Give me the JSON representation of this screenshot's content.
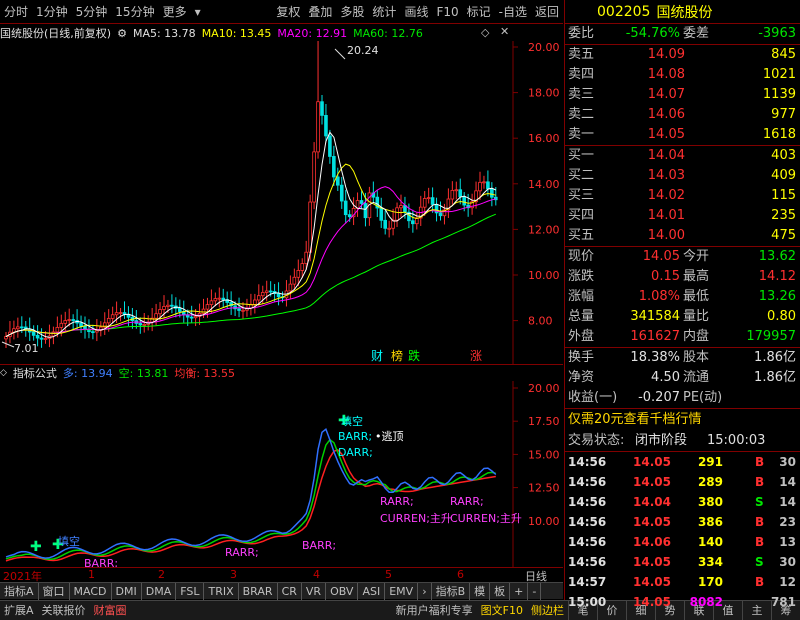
{
  "toolbar": {
    "left": [
      "分时",
      "1分钟",
      "5分钟",
      "15分钟",
      "更多"
    ],
    "right": [
      "复权",
      "叠加",
      "多股",
      "统计",
      "画线",
      "F10",
      "标记",
      "-自选",
      "返回"
    ]
  },
  "main_info": {
    "title": "国统股份(日线,前复权)",
    "ma5": "MA5: 13.78",
    "ma10": "MA10: 13.45",
    "ma20": "MA20: 12.91",
    "ma60": "MA60: 12.76"
  },
  "main_axis": [
    "20.00",
    "18.00",
    "16.00",
    "14.00",
    "12.00",
    "10.00",
    "8.00"
  ],
  "main_labels": {
    "high": "20.24",
    "low": "7.01",
    "tag1": "财",
    "tag2": "榜",
    "tag3": "跌",
    "tag4": "涨"
  },
  "sub_info": {
    "name": "指标公式",
    "duo": "多: 13.94",
    "kong": "空: 13.81",
    "junheng": "均衡: 13.55"
  },
  "sub_axis": [
    "20.00",
    "17.50",
    "15.00",
    "12.50",
    "10.00"
  ],
  "sub_labels": {
    "tiankong": "填空",
    "barr": "BARR;",
    "taoding": "•逃顶",
    "darr": "DARR;",
    "rarr": "RARR;",
    "curren": "CURREN;主升",
    "curren2": "CURREN;主升",
    "tiankong2": "填空",
    "barr2": "BARR;",
    "rarr_small": "RARR;"
  },
  "dates": {
    "year": "2021年",
    "m1": "1",
    "m2": "2",
    "m3": "3",
    "m4": "4",
    "m5": "5",
    "m6": "6",
    "period": "日线"
  },
  "tabs": [
    "指标A",
    "窗口",
    "MACD",
    "DMI",
    "DMA",
    "FSL",
    "TRIX",
    "BRAR",
    "CR",
    "VR",
    "OBV",
    "ASI",
    "EMV",
    "指标B",
    "模",
    "板",
    "+",
    "-"
  ],
  "bottom": {
    "items": [
      "扩展A",
      "关联报价",
      "财富圈"
    ],
    "promo": "新用户福利专享",
    "f10": "图文F10",
    "side": "侧边栏",
    "small": [
      "笔",
      "价",
      "细",
      "势",
      "联",
      "值",
      "主",
      "筹"
    ]
  },
  "quote": {
    "code": "002205",
    "name": "国统股份",
    "weibi_label": "委比",
    "weibi": "-54.76%",
    "weicha_label": "委差",
    "weicha": "-3963",
    "asks": [
      {
        "label": "卖五",
        "price": "14.09",
        "vol": "845"
      },
      {
        "label": "卖四",
        "price": "14.08",
        "vol": "1021"
      },
      {
        "label": "卖三",
        "price": "14.07",
        "vol": "1139"
      },
      {
        "label": "卖二",
        "price": "14.06",
        "vol": "977"
      },
      {
        "label": "卖一",
        "price": "14.05",
        "vol": "1618"
      }
    ],
    "bids": [
      {
        "label": "买一",
        "price": "14.04",
        "vol": "403"
      },
      {
        "label": "买二",
        "price": "14.03",
        "vol": "409"
      },
      {
        "label": "买三",
        "price": "14.02",
        "vol": "115"
      },
      {
        "label": "买四",
        "price": "14.01",
        "vol": "235"
      },
      {
        "label": "买五",
        "price": "14.00",
        "vol": "475"
      }
    ],
    "stats": [
      {
        "l1": "现价",
        "v1": "14.05",
        "c1": "red",
        "l2": "今开",
        "v2": "13.62",
        "c2": "green"
      },
      {
        "l1": "涨跌",
        "v1": "0.15",
        "c1": "red",
        "l2": "最高",
        "v2": "14.12",
        "c2": "red"
      },
      {
        "l1": "涨幅",
        "v1": "1.08%",
        "c1": "red",
        "l2": "最低",
        "v2": "13.26",
        "c2": "green"
      },
      {
        "l1": "总量",
        "v1": "341584",
        "c1": "yellow",
        "l2": "量比",
        "v2": "0.80",
        "c2": "yellow"
      },
      {
        "l1": "外盘",
        "v1": "161627",
        "c1": "red",
        "l2": "内盘",
        "v2": "179957",
        "c2": "green"
      }
    ],
    "stats2": [
      {
        "l1": "换手",
        "v1": "18.38%",
        "l2": "股本",
        "v2": "1.86亿"
      },
      {
        "l1": "净资",
        "v1": "4.50",
        "l2": "流通",
        "v2": "1.86亿"
      },
      {
        "l1": "收益(一)",
        "v1": "-0.207",
        "l2": "PE(动)",
        "v2": ""
      }
    ],
    "promo": "仅需20元查看千档行情",
    "status_label": "交易状态:",
    "status_value": "闭市阶段",
    "status_time": "15:00:03",
    "trades": [
      {
        "t": "14:56",
        "p": "14.05",
        "q": "291",
        "bs": "B",
        "n": "30"
      },
      {
        "t": "14:56",
        "p": "14.05",
        "q": "289",
        "bs": "B",
        "n": "14"
      },
      {
        "t": "14:56",
        "p": "14.04",
        "q": "380",
        "bs": "S",
        "n": "14"
      },
      {
        "t": "14:56",
        "p": "14.05",
        "q": "386",
        "bs": "B",
        "n": "23"
      },
      {
        "t": "14:56",
        "p": "14.06",
        "q": "140",
        "bs": "B",
        "n": "13"
      },
      {
        "t": "14:56",
        "p": "14.05",
        "q": "334",
        "bs": "S",
        "n": "30"
      },
      {
        "t": "14:57",
        "p": "14.05",
        "q": "170",
        "bs": "B",
        "n": "12"
      },
      {
        "t": "15:00",
        "p": "14.05",
        "q": "8082",
        "bs": "",
        "n": "781"
      }
    ]
  },
  "colors": {
    "up": "#ff3030",
    "down": "#00e600",
    "axis": "#800000",
    "ma5": "#ffffff",
    "ma10": "#ffff00",
    "ma20": "#ff00ff",
    "ma60": "#00ff00"
  }
}
